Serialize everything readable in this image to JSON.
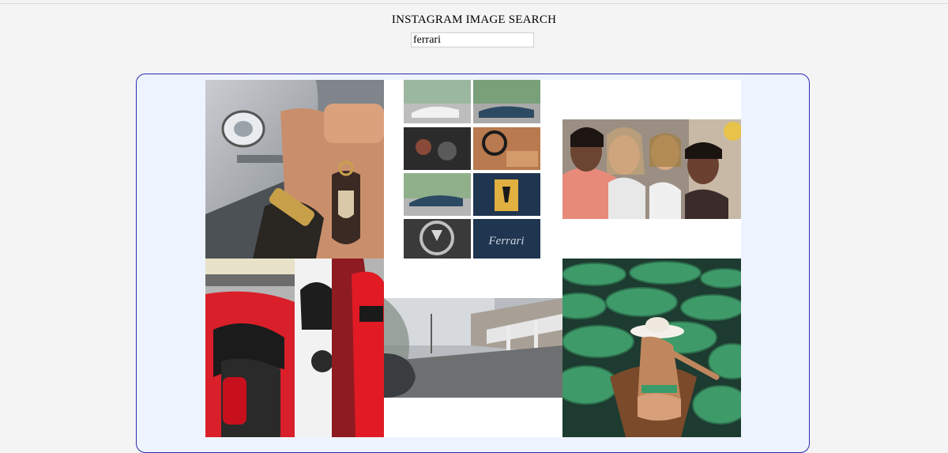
{
  "page": {
    "title": "INSTAGRAM IMAGE SEARCH"
  },
  "search": {
    "value": "ferrari"
  },
  "results": {
    "images": [
      {
        "id": "hand-porsche-keychain"
      },
      {
        "id": "classic-ferrari-collage"
      },
      {
        "id": "group-selfie-women"
      },
      {
        "id": "red-sports-cars-showroom"
      },
      {
        "id": "road-fence-car"
      },
      {
        "id": "woman-lily-pads-boat"
      }
    ]
  }
}
